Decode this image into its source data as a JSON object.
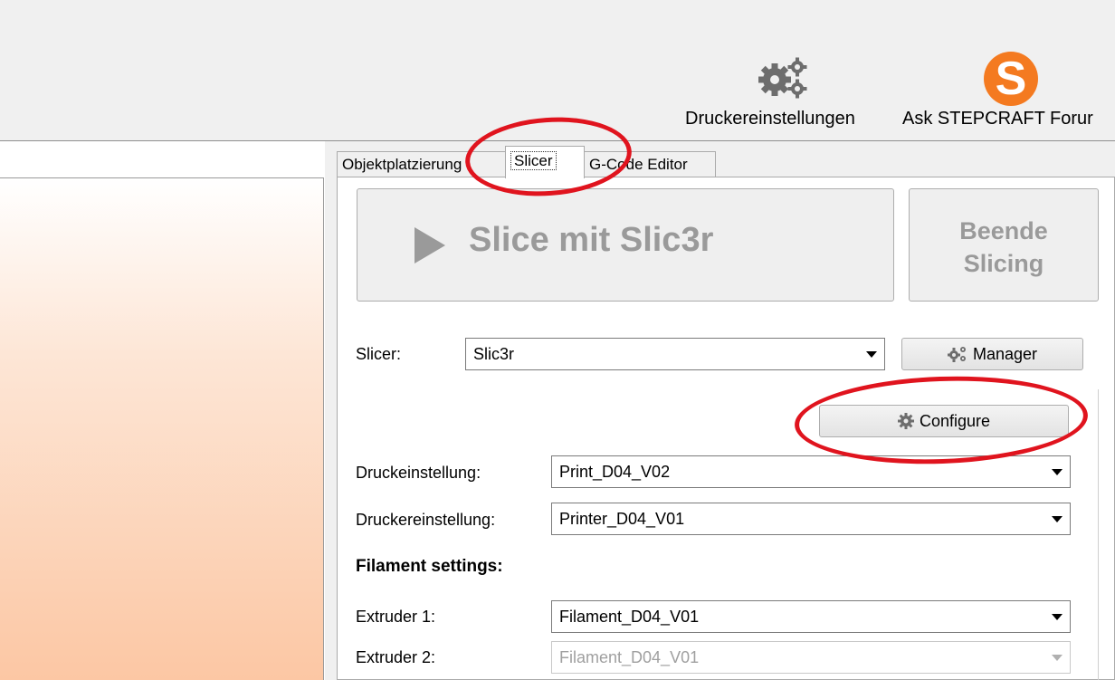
{
  "toolbar": {
    "printer_settings_label": "Druckereinstellungen",
    "ask_forum_label": "Ask STEPCRAFT Forur",
    "logo_letter": "S",
    "accent_color": "#f47a20"
  },
  "tabs": {
    "object_placement": "Objektplatzierung",
    "slicer": "Slicer",
    "gcode_editor": "G-Code Editor",
    "active": "Slicer"
  },
  "slicer_panel": {
    "slice_button": "Slice mit Slic3r",
    "stop_button": "Beende Slicing",
    "slicer_label": "Slicer:",
    "slicer_value": "Slic3r",
    "manager_button": "Manager",
    "configure_button": "Configure",
    "print_setting_label": "Druckeinstellung:",
    "print_setting_value": "Print_D04_V02",
    "printer_setting_label": "Druckereinstellung:",
    "printer_setting_value": "Printer_D04_V01",
    "filament_heading": "Filament settings:",
    "extruder1_label": "Extruder 1:",
    "extruder1_value": "Filament_D04_V01",
    "extruder2_label": "Extruder 2:",
    "extruder2_value": "Filament_D04_V01"
  },
  "annotations": {
    "highlight_color": "#e0141e"
  }
}
